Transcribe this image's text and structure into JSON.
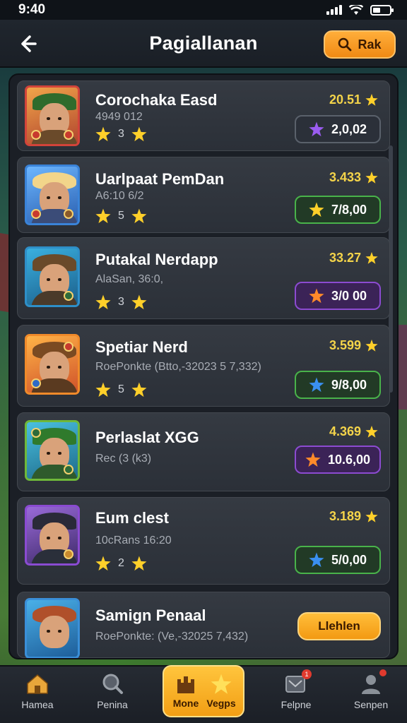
{
  "status_bar": {
    "time": "9:40"
  },
  "header": {
    "title": "Pagiallanan",
    "rank_button": "Rak"
  },
  "colors": {
    "accent": "#f08a14",
    "star": "#ffd02a",
    "score": "#f4d44a"
  },
  "players": [
    {
      "name": "Corochaka Easd",
      "sub": "4949 012",
      "stars": "3",
      "score": "20.51",
      "value": "2,0,02",
      "pill": "grey",
      "pill_star": "purple-star-icon"
    },
    {
      "name": "Uarlpaat PemDan",
      "sub": "A6:10 6/2",
      "stars": "5",
      "score": "3.433",
      "value": "7/8,00",
      "pill": "green",
      "pill_star": "gold-star-icon"
    },
    {
      "name": "Putakal Nerdapp",
      "sub": "AlaSan, 36:0,",
      "stars": "3",
      "score": "33.27",
      "value": "3/0 00",
      "pill": "purple",
      "pill_star": "orange-star-icon"
    },
    {
      "name": "Spetiar Nerd",
      "sub": "RoePonkte (Btto,-32023 5 7,332)",
      "stars": "5",
      "score": "3.599",
      "value": "9/8,00",
      "pill": "green",
      "pill_star": "blue-star-icon"
    },
    {
      "name": "Perlaslat XGG",
      "sub": "Rec (3 (k3)",
      "stars": "",
      "score": "4.369",
      "value": "10.6,00",
      "pill": "purple",
      "pill_star": "orange-star-icon"
    },
    {
      "name": "Eum clest",
      "sub": "10cRans 16:20",
      "stars": "2",
      "score": "3.189",
      "value": "5/0,00",
      "pill": "green",
      "pill_star": "blue-star-icon"
    },
    {
      "name": "Samign Penaal",
      "sub": "RoePonkte: (Ve,-32025 7,432)",
      "button": "Llehlen"
    }
  ],
  "nav": {
    "home": "Hamea",
    "search": "Penina",
    "center_left": "Mone",
    "center_right": "Vegps",
    "messages": "Felpne",
    "messages_badge": "1",
    "profile": "Senpen"
  }
}
